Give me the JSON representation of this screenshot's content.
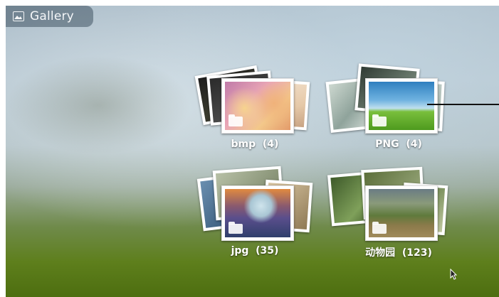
{
  "app": {
    "title": "Gallery",
    "icon": "picture-icon"
  },
  "albums": [
    {
      "name": "bmp",
      "count": "(4)",
      "label": "bmp  (4)"
    },
    {
      "name": "PNG",
      "count": "(4)",
      "label": "PNG  (4)"
    },
    {
      "name": "jpg",
      "count": "(35)",
      "label": "jpg  (35)"
    },
    {
      "name": "动物园",
      "count": "(123)",
      "label": "动物园  (123)"
    }
  ],
  "colors": {
    "label_text": "#ffffff",
    "chip_background": "rgba(40,60,75,0.45)",
    "ground_green": "#5e7f1c",
    "sky_blue": "#b8c8d2"
  },
  "cursor": {
    "icon": "mouse-pointer-icon"
  }
}
